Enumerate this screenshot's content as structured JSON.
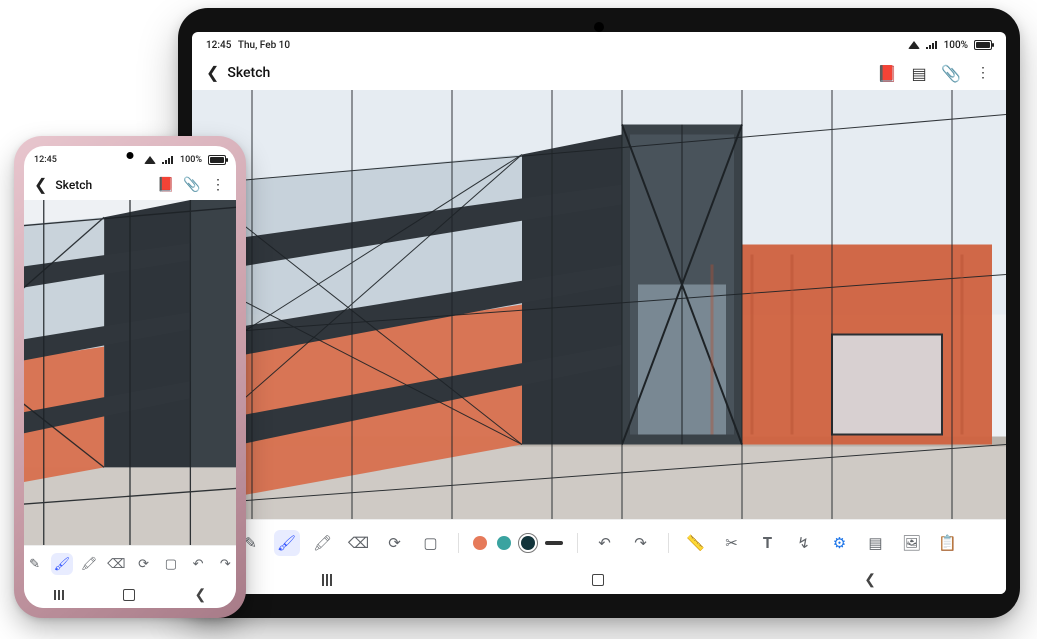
{
  "tablet": {
    "status": {
      "time": "12:45",
      "date": "Thu, Feb 10",
      "battery": "100%"
    },
    "appbar": {
      "title": "Sketch",
      "actions": {
        "reader": "reader-mode-icon",
        "page": "page-icon",
        "attach": "attachment-icon",
        "more": "more-icon"
      }
    },
    "toolbar": {
      "tools": {
        "pen": "pen",
        "brush": "brush",
        "highlighter": "highlighter",
        "eraser": "eraser",
        "lasso": "lasso",
        "shape": "shape"
      },
      "colors": [
        "#e67a5a",
        "#3aa3a0",
        "#12343b"
      ],
      "selected_color_index": 2,
      "more": {
        "undo": "undo",
        "redo": "redo",
        "ruler": "ruler",
        "crop": "crop",
        "text": "text",
        "text_style": "text-style",
        "insert": "insert",
        "layers": "layers",
        "image": "image",
        "clipboard": "clipboard"
      }
    }
  },
  "phone": {
    "status": {
      "time": "12:45",
      "battery": "100%"
    },
    "appbar": {
      "title": "Sketch",
      "actions": {
        "reader": "reader-mode-icon",
        "attach": "attachment-icon",
        "more": "more-icon"
      }
    },
    "toolbar": {
      "tools": {
        "pen": "pen",
        "brush": "brush",
        "highlighter": "highlighter",
        "eraser": "eraser",
        "lasso": "lasso",
        "shape": "shape",
        "undo": "undo",
        "redo": "redo"
      }
    }
  },
  "sketch": {
    "description": "Architectural watercolor-style sketch of a modern multi-story building with orange-red facade blocks, dark vertical tower, glass windows and perspective construction lines.",
    "palette": {
      "orange": "#d96a46",
      "dark": "#2b2f33",
      "steel": "#6b7d88",
      "pale": "#d9dde0"
    }
  }
}
